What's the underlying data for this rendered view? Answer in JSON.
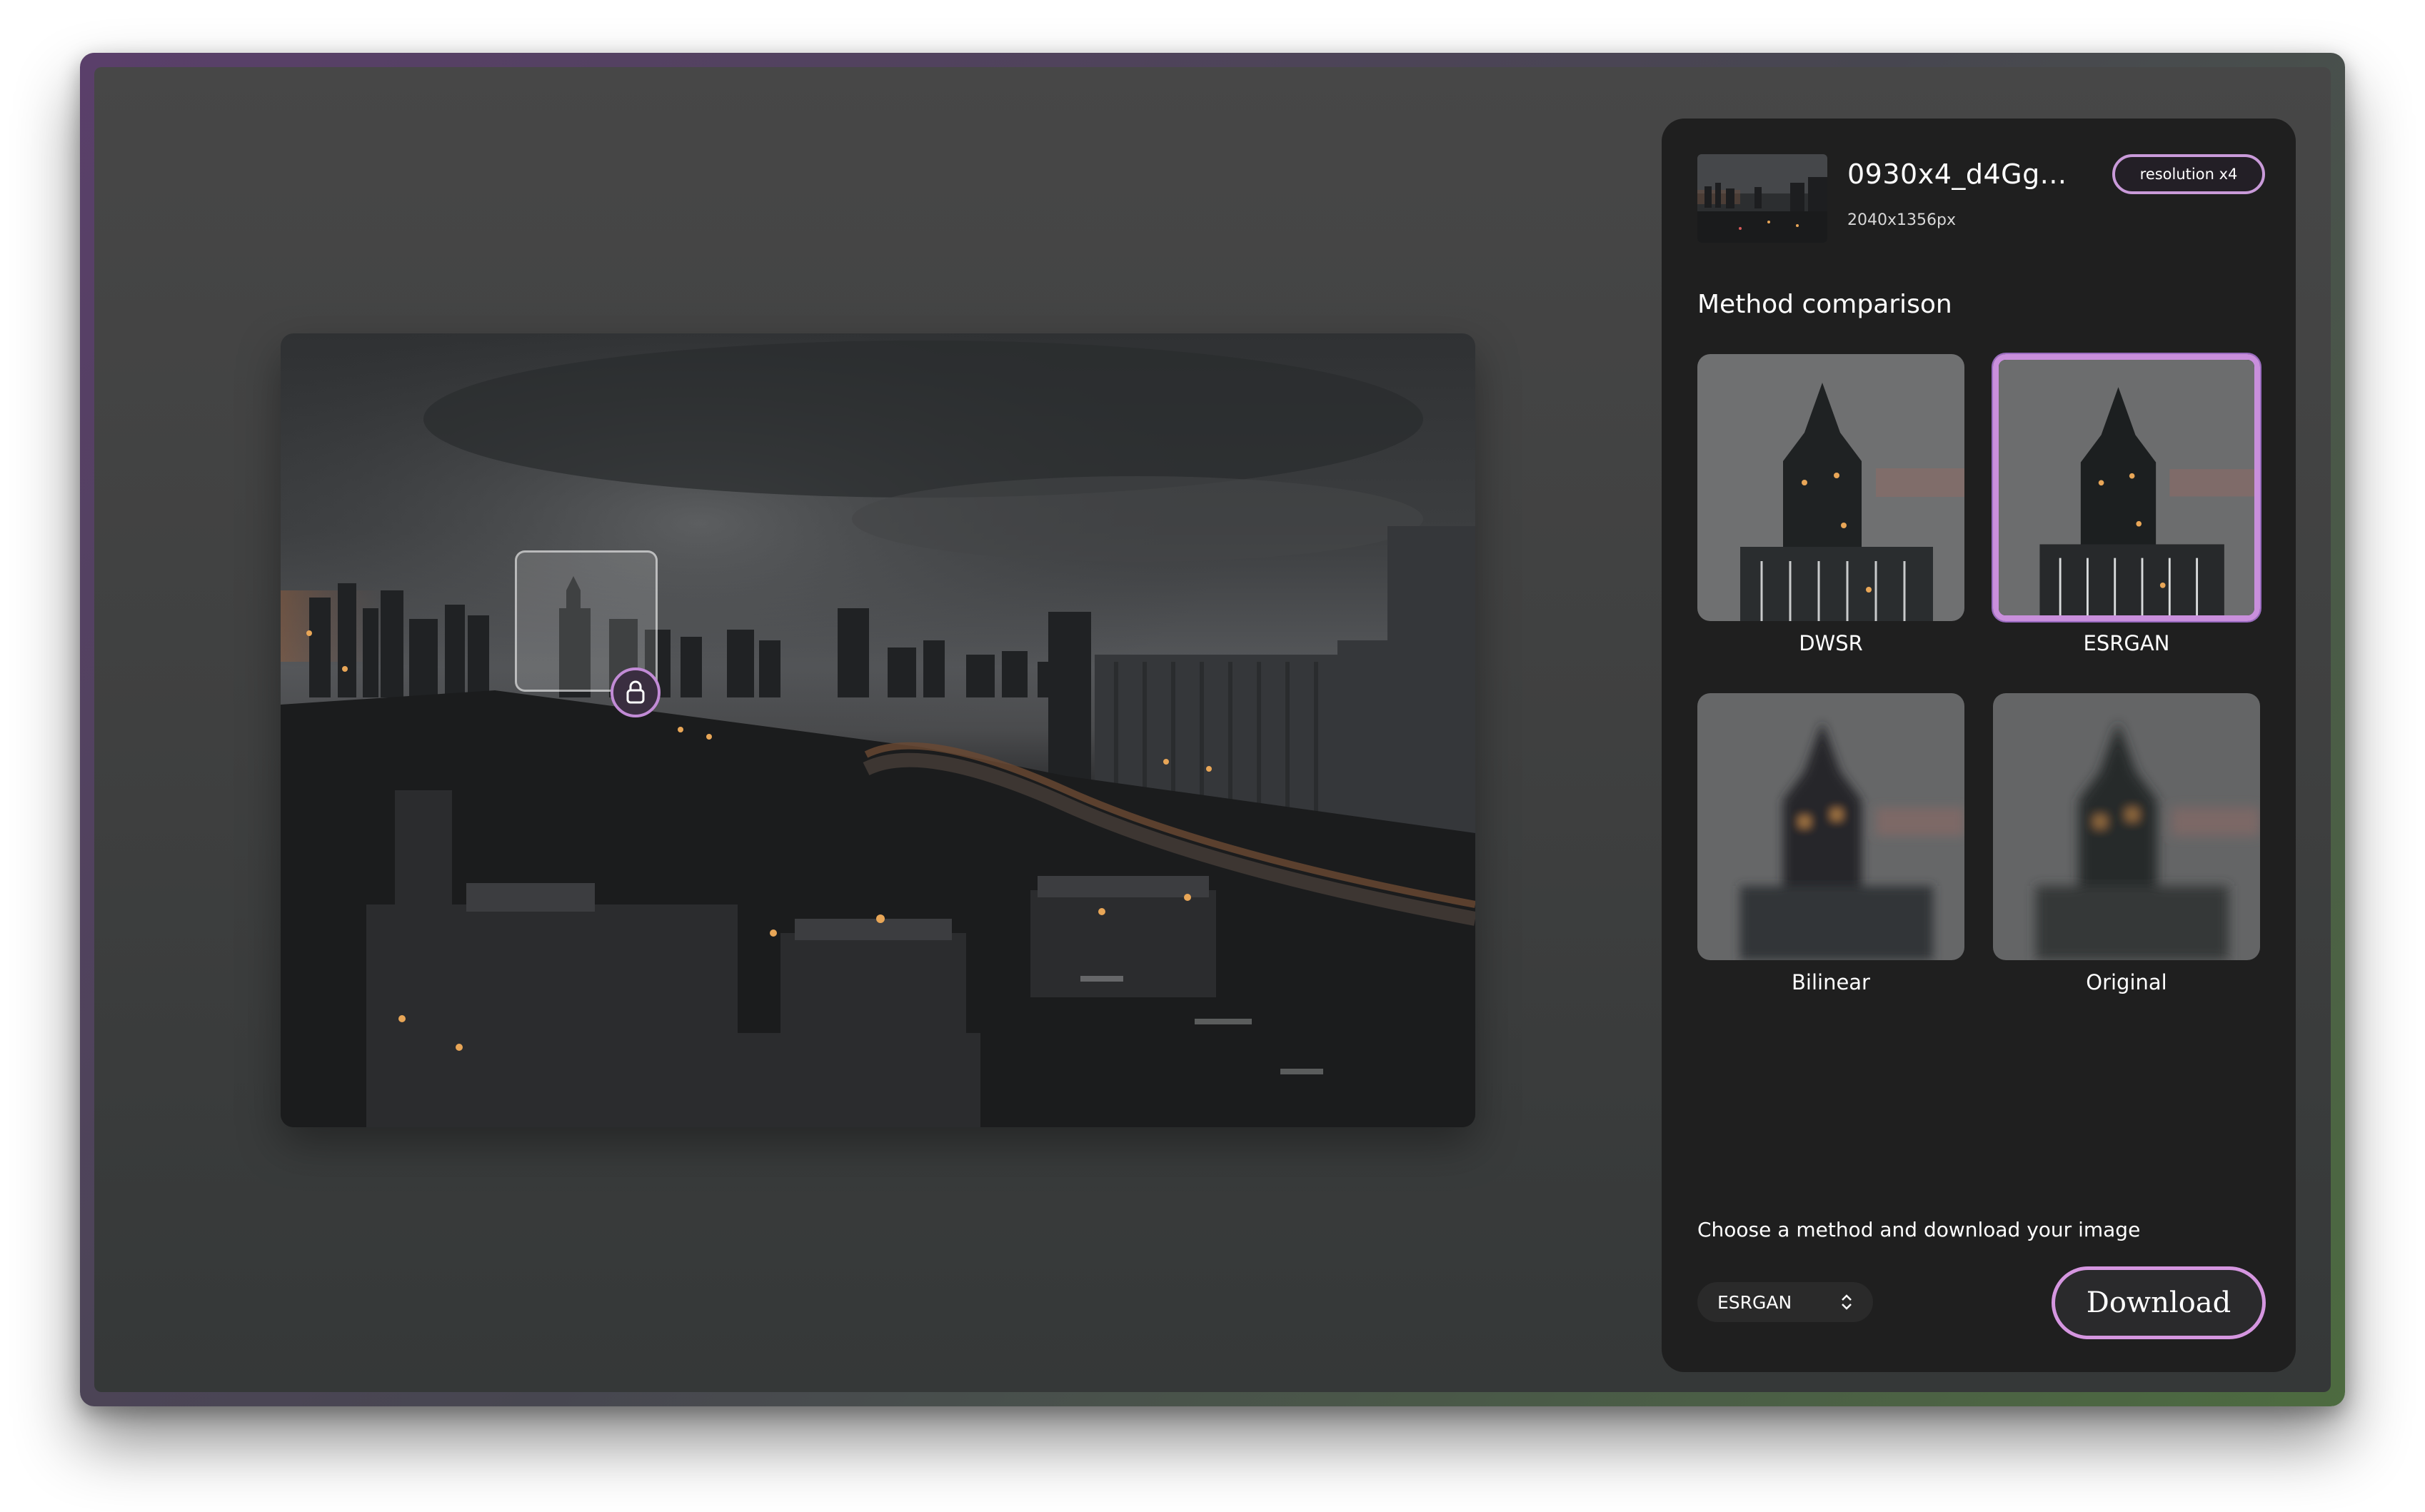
{
  "file": {
    "name": "0930x4_d4Gg...",
    "dimensions": "2040x1356px",
    "badge": "resolution x4"
  },
  "comparison": {
    "title": "Method comparison",
    "methods": [
      {
        "label": "DWSR",
        "selected": false,
        "blur": "sharp"
      },
      {
        "label": "ESRGAN",
        "selected": true,
        "blur": "sharp"
      },
      {
        "label": "Bilinear",
        "selected": false,
        "blur": "blurry"
      },
      {
        "label": "Original",
        "selected": false,
        "blur": "blurry"
      }
    ]
  },
  "footer": {
    "instruction": "Choose a method and download your image",
    "selected_method": "ESRGAN",
    "download_label": "Download"
  },
  "icons": {
    "lock": "lock-icon",
    "select_arrows": "chevron-up-down-icon"
  },
  "colors": {
    "accent": "#c98fdc",
    "panel_bg": "#1f1f1f",
    "window_gradient_start": "#5a3f6a",
    "window_gradient_end": "#4d6b40"
  }
}
